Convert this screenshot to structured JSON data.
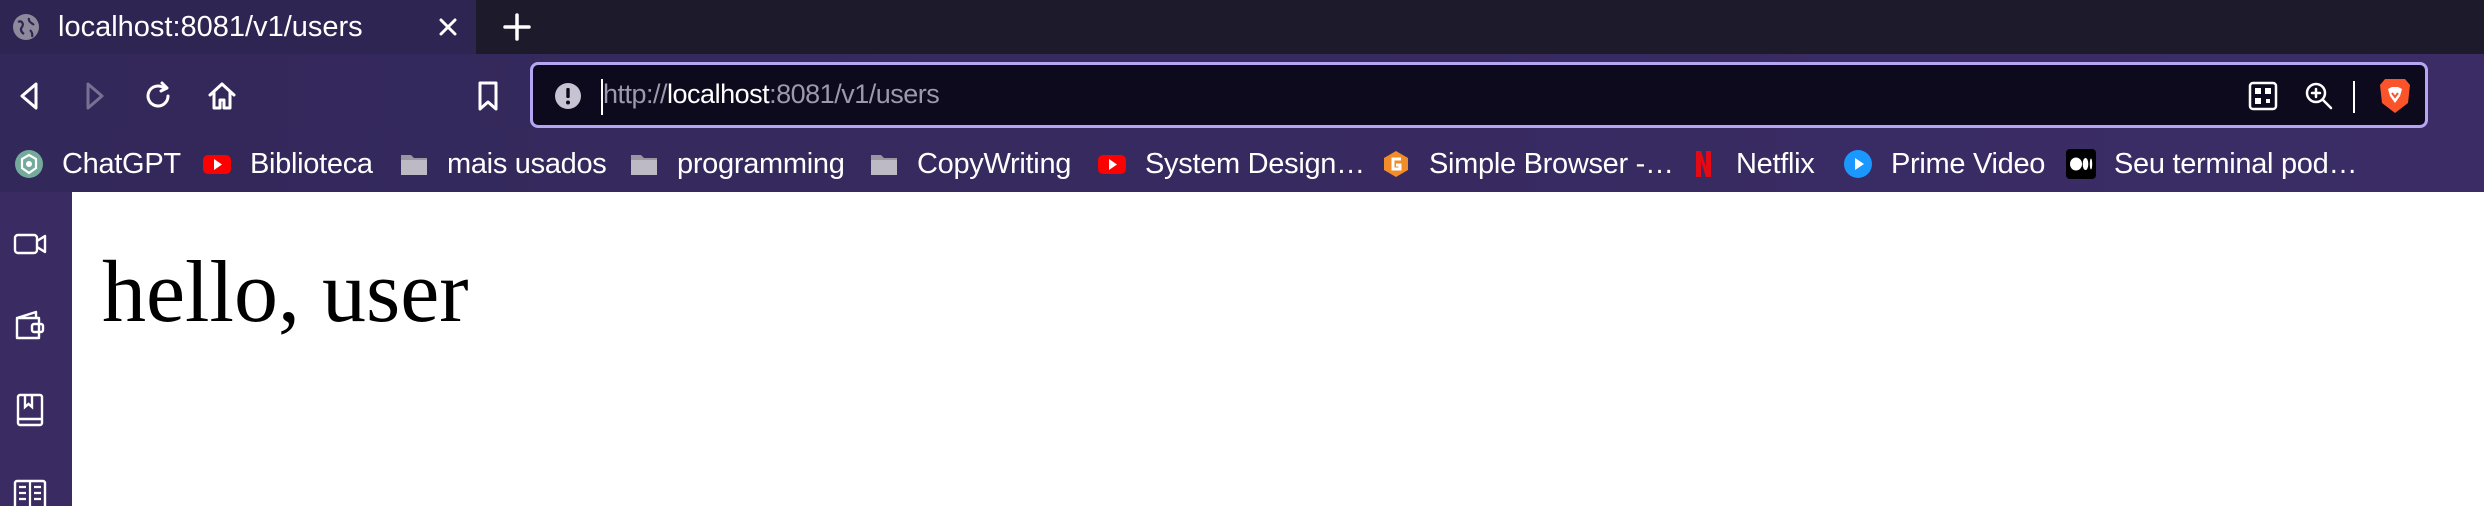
{
  "tab": {
    "title": "localhost:8081/v1/users",
    "favicon": "globe-icon",
    "close_icon": "close-icon",
    "new_tab_icon": "plus-icon"
  },
  "toolbar": {
    "back_icon": "back-arrow-icon",
    "forward_icon": "forward-arrow-icon",
    "reload_icon": "reload-icon",
    "home_icon": "home-icon",
    "bookmark_icon": "bookmark-icon"
  },
  "address_bar": {
    "scheme": "http://",
    "host": "localhost",
    "path": ":8081/v1/users",
    "site_info_icon": "info-icon",
    "qr_icon": "qr-code-icon",
    "zoom_icon": "zoom-icon",
    "brave_icon": "brave-lion-icon"
  },
  "bookmarks": [
    {
      "label": "ChatGPT",
      "icon": "chatgpt-icon"
    },
    {
      "label": "Biblioteca",
      "icon": "youtube-icon"
    },
    {
      "label": "mais usados",
      "icon": "folder-icon"
    },
    {
      "label": "programming",
      "icon": "folder-icon"
    },
    {
      "label": "CopyWriting",
      "icon": "folder-icon"
    },
    {
      "label": "System Design…",
      "icon": "youtube-icon"
    },
    {
      "label": "Simple Browser -…",
      "icon": "simple-browser-icon"
    },
    {
      "label": "Netflix",
      "icon": "netflix-icon"
    },
    {
      "label": "Prime Video",
      "icon": "prime-video-icon"
    },
    {
      "label": "Seu terminal pod…",
      "icon": "medium-icon"
    }
  ],
  "side_panel": [
    "video-call-icon",
    "wallet-icon",
    "reading-list-icon",
    "news-icon"
  ],
  "colors": {
    "tabstrip": "#1d1a2c",
    "active_tab": "#2f2552",
    "toolbar": "#33285a",
    "address_border": "#b6a5f2",
    "address_bg": "#0c0a1c"
  },
  "page": {
    "heading": "hello, user"
  }
}
